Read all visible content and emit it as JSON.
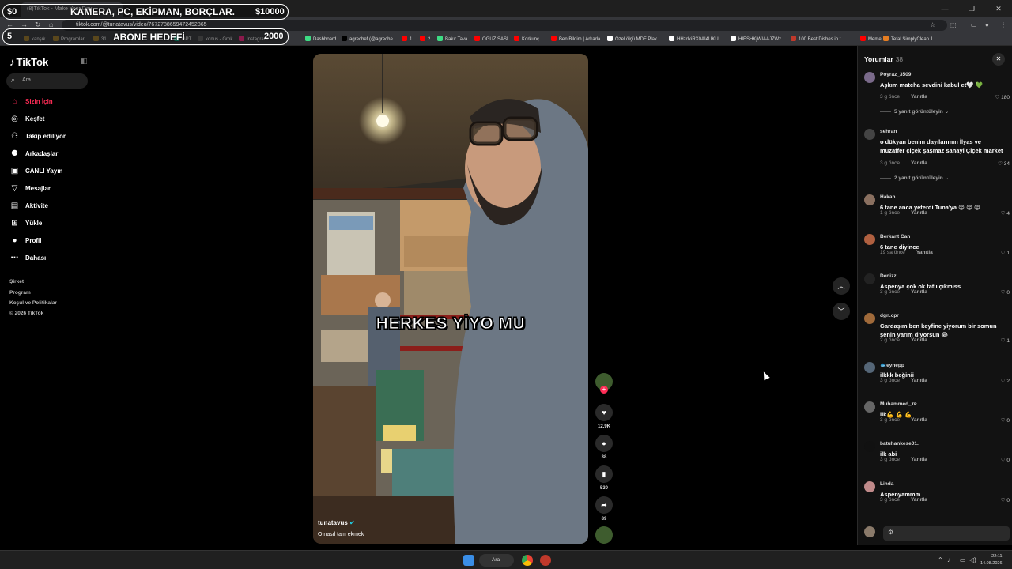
{
  "browser": {
    "tab_title": "(8)TikTok - Make Your Day",
    "url": "tiktok.com/@tunatavus/video/7672788659472452865",
    "bookmarks": [
      {
        "label": "kanşık",
        "color": "#8a6d2c"
      },
      {
        "label": "Programlar",
        "color": "#8a6d2c"
      },
      {
        "label": "31",
        "color": "#8a6d2c"
      },
      {
        "label": "GPT",
        "color": "#10a37f"
      },
      {
        "label": "konuş - Grok",
        "color": "#555555"
      },
      {
        "label": "Instagram",
        "color": "#d62976"
      },
      {
        "label": "Dashboard",
        "color": "#3ddc84"
      },
      {
        "label": "agrechef (@agreche...",
        "color": "#000000"
      },
      {
        "label": "1",
        "color": "#ff0000"
      },
      {
        "label": "2",
        "color": "#ff0000"
      },
      {
        "label": "Bakır Tava",
        "color": "#3ddc84"
      },
      {
        "label": "OĞUZ SASİ",
        "color": "#ff0000"
      },
      {
        "label": "Korkunç",
        "color": "#ff0000"
      },
      {
        "label": "Ben Bildim | Arkada...",
        "color": "#ff0000"
      },
      {
        "label": "Özel ölçü MDF Plak...",
        "color": "#ffffff"
      },
      {
        "label": "HHzdkiRX0AI4UKU...",
        "color": "#ffffff"
      },
      {
        "label": "HIESHKjWIAAJ7Wz...",
        "color": "#ffffff"
      },
      {
        "label": "100 Best Dishes in t...",
        "color": "#c0392b"
      },
      {
        "label": "Meme",
        "color": "#ff0000"
      },
      {
        "label": "Tefal SimplyClean 1...",
        "color": "#e67e22"
      }
    ]
  },
  "overlay": {
    "goal1_left": "$0",
    "goal1_text": "KAMERA, PC, EKİPMAN, BORÇLAR.",
    "goal1_right": "$10000",
    "goal2_left": "5",
    "goal2_text": "ABONE HEDEFİ",
    "goal2_right": "2000"
  },
  "sidebar": {
    "logo": "TikTok",
    "search_placeholder": "Ara",
    "items": [
      {
        "label": "Sizin İçin",
        "icon": "home-icon",
        "glyph": "⌂"
      },
      {
        "label": "Keşfet",
        "icon": "compass-icon",
        "glyph": "◎"
      },
      {
        "label": "Takip ediliyor",
        "icon": "following-icon",
        "glyph": "⚇"
      },
      {
        "label": "Arkadaşlar",
        "icon": "friends-icon",
        "glyph": "⚉"
      },
      {
        "label": "CANLI Yayın",
        "icon": "live-icon",
        "glyph": "▣"
      },
      {
        "label": "Mesajlar",
        "icon": "messages-icon",
        "glyph": "▽"
      },
      {
        "label": "Aktivite",
        "icon": "activity-icon",
        "glyph": "▤"
      },
      {
        "label": "Yükle",
        "icon": "upload-icon",
        "glyph": "⊞"
      },
      {
        "label": "Profil",
        "icon": "profile-icon",
        "glyph": "●"
      },
      {
        "label": "Dahası",
        "icon": "more-icon",
        "glyph": "⋯"
      }
    ],
    "footer": [
      "Şirket",
      "Program",
      "Koşul ve Politikalar",
      "© 2026 TikTok"
    ]
  },
  "video": {
    "caption": "HERKES YİYO MU",
    "author": "tunatavus",
    "description": "O nasıl tam ekmek",
    "likes": "12.9K",
    "comments": "38",
    "saves": "530",
    "shares": "89"
  },
  "comments_panel": {
    "title": "Yorumlar",
    "count": "38",
    "comments": [
      {
        "user": "Poyraz_3509",
        "text": "Aşkım matcha sevdini kabul et🤍 💚",
        "time": "3 g önce",
        "reply": "Yanıtla",
        "likes": "180",
        "replies": "5 yanıt görüntüleyin",
        "avatar": "#7a6a8a"
      },
      {
        "user": "sehran",
        "text": "o dükyan benim dayılarımın İlyas ve muzaffer çiçek şaşmaz sanayi Çiçek market",
        "time": "3 g önce",
        "reply": "Yanıtla",
        "likes": "34",
        "replies": "2 yanıt görüntüleyin",
        "avatar": "#444444"
      },
      {
        "user": "Hakan",
        "text": "6 tane anca yeterdi Tuna'ya 😡 😡 😡",
        "time": "1 g önce",
        "reply": "Yanıtla",
        "likes": "4",
        "replies": "",
        "avatar": "#8a7060"
      },
      {
        "user": "Berkant Can",
        "text": "6 tane diyince",
        "time": "19 sa önce",
        "reply": "Yanıtla",
        "likes": "1",
        "replies": "",
        "avatar": "#b06040"
      },
      {
        "user": "Denizz",
        "text": "Aspenya çok ok tatlı çıkmıss",
        "time": "3 g önce",
        "reply": "Yanıtla",
        "likes": "0",
        "replies": "",
        "avatar": "#222222"
      },
      {
        "user": "dgn.cpr",
        "text": "Gardaşım ben keyfine yiyorum bir somun senin yarım diyorsun 😂",
        "time": "2 g önce",
        "reply": "Yanıtla",
        "likes": "1",
        "replies": "",
        "avatar": "#a06a3a"
      },
      {
        "user": "🐟eynepp",
        "text": "ilkkk beğinii",
        "time": "3 g önce",
        "reply": "Yanıtla",
        "likes": "2",
        "replies": "",
        "avatar": "#556677"
      },
      {
        "user": "Muhammed_ᴛʀ",
        "text": "ilk💪 💪 💪",
        "time": "3 g önce",
        "reply": "Yanıtla",
        "likes": "0",
        "replies": "",
        "avatar": "#666666"
      },
      {
        "user": "batuhankese01.",
        "text": "ilk abi",
        "time": "3 g önce",
        "reply": "Yanıtla",
        "likes": "0",
        "replies": "",
        "avatar": "#111111"
      },
      {
        "user": "Linda",
        "text": "Aspenyammm",
        "time": "3 g önce",
        "reply": "Yanıtla",
        "likes": "0",
        "replies": "",
        "avatar": "#c08a8a"
      }
    ],
    "input_icon": "emoji-icon"
  },
  "taskbar": {
    "search_label": "Ara",
    "time": "22:11",
    "date": "14.08.2026"
  }
}
